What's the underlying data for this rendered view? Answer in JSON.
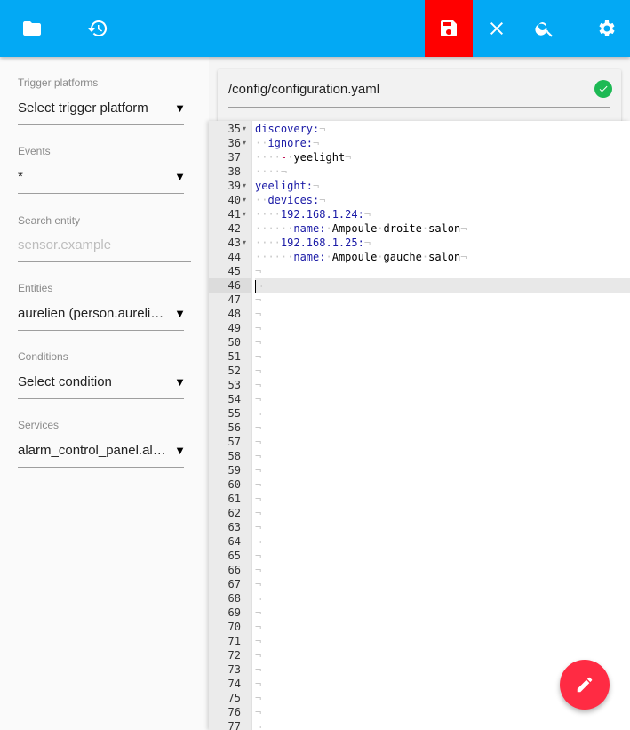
{
  "toolbar": {
    "bg_color": "#03a9f4",
    "save_highlight_color": "#ff0000",
    "buttons": [
      {
        "name": "folder-button",
        "icon": "folder-icon"
      },
      {
        "name": "history-button",
        "icon": "history-icon"
      },
      {
        "name": "save-button",
        "icon": "save-icon"
      },
      {
        "name": "close-button",
        "icon": "close-icon"
      },
      {
        "name": "search-button",
        "icon": "search-icon"
      },
      {
        "name": "settings-button",
        "icon": "gear-icon"
      }
    ]
  },
  "sidebar": {
    "trigger_platforms": {
      "label": "Trigger platforms",
      "value": "Select trigger platform"
    },
    "events": {
      "label": "Events",
      "value": "*"
    },
    "search_entity": {
      "label": "Search entity",
      "placeholder": "sensor.example",
      "value": ""
    },
    "entities": {
      "label": "Entities",
      "value": "aurelien (person.aurelien)"
    },
    "conditions": {
      "label": "Conditions",
      "value": "Select condition"
    },
    "services": {
      "label": "Services",
      "value": "alarm_control_panel.alarm_arm_away"
    },
    "dropdown_arrow": "▼"
  },
  "file": {
    "path": "/config/configuration.yaml",
    "status_icon": "check-circle-icon",
    "status_color": "#1db954"
  },
  "editor": {
    "first_line": 35,
    "last_line": 77,
    "active_line": 46,
    "lines": [
      {
        "n": 35,
        "fold": true,
        "indent": 0,
        "key": "discovery:",
        "text": ""
      },
      {
        "n": 36,
        "fold": true,
        "indent": 2,
        "key": "ignore:",
        "text": ""
      },
      {
        "n": 37,
        "fold": false,
        "indent": 4,
        "dash": "-",
        "key": "",
        "text": "yeelight"
      },
      {
        "n": 38,
        "fold": false,
        "indent": 4,
        "key": "",
        "text": ""
      },
      {
        "n": 39,
        "fold": true,
        "indent": 0,
        "key": "yeelight:",
        "text": ""
      },
      {
        "n": 40,
        "fold": true,
        "indent": 2,
        "key": "devices:",
        "text": ""
      },
      {
        "n": 41,
        "fold": true,
        "indent": 4,
        "key": "192.168.1.24:",
        "text": ""
      },
      {
        "n": 42,
        "fold": false,
        "indent": 6,
        "key": "name:",
        "text": "Ampoule droite salon"
      },
      {
        "n": 43,
        "fold": true,
        "indent": 4,
        "key": "192.168.1.25:",
        "text": ""
      },
      {
        "n": 44,
        "fold": false,
        "indent": 6,
        "key": "name:",
        "text": "Ampoule gauche salon"
      },
      {
        "n": 45,
        "fold": false,
        "indent": 0,
        "key": "",
        "text": ""
      },
      {
        "n": 46,
        "fold": false,
        "indent": 0,
        "key": "",
        "text": ""
      }
    ]
  },
  "fab": {
    "icon": "pencil-icon",
    "color": "#ff2b43"
  }
}
